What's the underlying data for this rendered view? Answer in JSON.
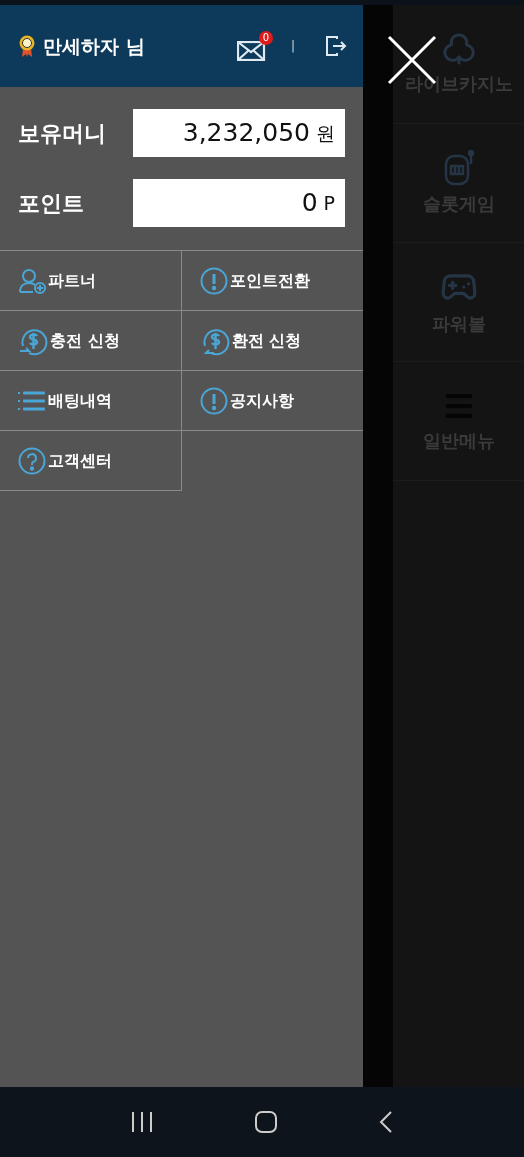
{
  "header": {
    "username": "만세하자 님",
    "mail_count": "0",
    "separator": "|"
  },
  "balances": [
    {
      "label": "보유머니",
      "value": "3,232,050",
      "unit": "원"
    },
    {
      "label": "포인트",
      "value": "0",
      "unit": "P"
    }
  ],
  "menu": [
    {
      "kind": "partner",
      "label": "파트너"
    },
    {
      "kind": "alert",
      "label": "포인트전환"
    },
    {
      "kind": "deposit",
      "label": "충전 신청"
    },
    {
      "kind": "withdraw",
      "label": "환전 신청"
    },
    {
      "kind": "list",
      "label": "배팅내역"
    },
    {
      "kind": "alert",
      "label": "공지사항"
    },
    {
      "kind": "help",
      "label": "고객센터"
    }
  ],
  "side_menu": [
    {
      "kind": "cards",
      "label": "라이브카지노"
    },
    {
      "kind": "slot",
      "label": "슬롯게임"
    },
    {
      "kind": "gamepad",
      "label": "파워볼"
    },
    {
      "kind": "menu",
      "label": "일반메뉴"
    }
  ]
}
